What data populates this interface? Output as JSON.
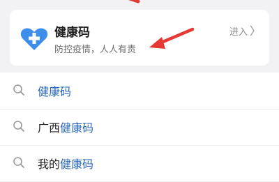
{
  "card": {
    "title": "健康码",
    "subtitle": "防控疫情，人人有责",
    "enter_label": "进入",
    "chevron": "〉",
    "icon": "heart-plus-icon",
    "icon_color": "#3d8eea"
  },
  "suggestions": [
    {
      "prefix": "",
      "highlight": "健康码"
    },
    {
      "prefix": "广西",
      "highlight": "健康码"
    },
    {
      "prefix": "我的",
      "highlight": "健康码"
    }
  ],
  "colors": {
    "annotation_arrow": "#e53935",
    "highlight_text": "#2a66b8",
    "background": "#f2f2f4"
  }
}
